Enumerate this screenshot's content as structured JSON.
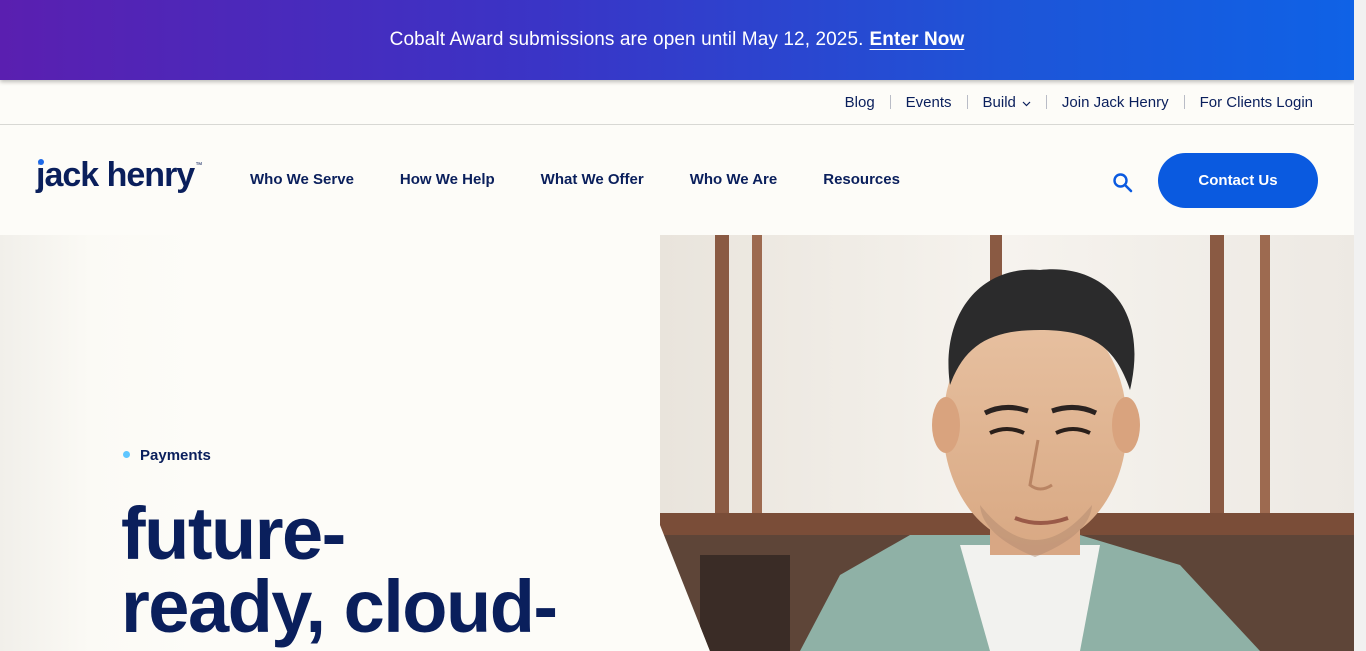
{
  "announcement": {
    "text": "Cobalt Award submissions are open until May 12, 2025.",
    "cta": "Enter Now",
    "gradient": [
      "#5a1fb0",
      "#0f62e6"
    ]
  },
  "utility_nav": {
    "items": [
      "Blog",
      "Events",
      "Build",
      "Join Jack Henry",
      "For Clients Login"
    ],
    "build_chevron": "chevron-down-icon"
  },
  "brand": {
    "logo_text": "jack henry",
    "trademark": "™",
    "color": "#0a1f5c",
    "accent": "#1d69e8"
  },
  "main_nav": {
    "items": [
      "Who We Serve",
      "How We Help",
      "What We Offer",
      "Who We Are",
      "Resources"
    ],
    "search_icon": "search-icon",
    "contact_label": "Contact Us",
    "contact_color": "#0a5ae0"
  },
  "hero": {
    "eyebrow": "Payments",
    "eyebrow_dot_color": "#5fc6ff",
    "headline_line1": "future-",
    "headline_line2": "ready, cloud-"
  }
}
